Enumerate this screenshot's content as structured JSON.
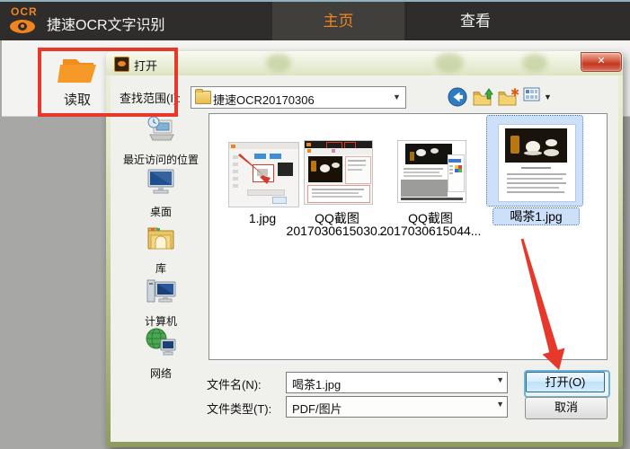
{
  "app": {
    "logo_text": "OCR",
    "title": "捷速OCR文字识别",
    "tabs": [
      {
        "label": "主页",
        "active": true
      },
      {
        "label": "查看",
        "active": false
      }
    ],
    "toolbar": {
      "read_label": "读取"
    }
  },
  "dialog": {
    "title": "打开",
    "close_glyph": "✕",
    "address": {
      "label": "查找范围(I):",
      "value": "捷速OCR20170306",
      "nav_icons": [
        "back-icon",
        "up-folder-icon",
        "new-folder-icon",
        "view-menu-icon"
      ]
    },
    "places": [
      {
        "label": "最近访问的位置",
        "icon": "recent-places-icon"
      },
      {
        "label": "桌面",
        "icon": "desktop-icon"
      },
      {
        "label": "库",
        "icon": "libraries-icon"
      },
      {
        "label": "计算机",
        "icon": "computer-icon"
      },
      {
        "label": "网络",
        "icon": "network-icon"
      }
    ],
    "files": [
      {
        "lines": [
          "1.jpg"
        ],
        "selected": false
      },
      {
        "lines": [
          "QQ截图",
          "2017030615030..."
        ],
        "selected": false
      },
      {
        "lines": [
          "QQ截图",
          "2017030615044..."
        ],
        "selected": false
      },
      {
        "lines": [
          "喝茶1.jpg"
        ],
        "selected": true
      }
    ],
    "filename": {
      "label": "文件名(N):",
      "value": "喝茶1.jpg"
    },
    "filetype": {
      "label": "文件类型(T):",
      "value": "PDF/图片"
    },
    "buttons": {
      "open": "打开(O)",
      "cancel": "取消"
    }
  },
  "colors": {
    "accent_orange": "#f08421",
    "titlebar_dark": "#2e2d2b",
    "annotation_red": "#e6392b",
    "selection_blue": "#cde0fa",
    "dialog_frame_olive": "#8d9b5e",
    "default_button_glow": "#69b4dd"
  }
}
